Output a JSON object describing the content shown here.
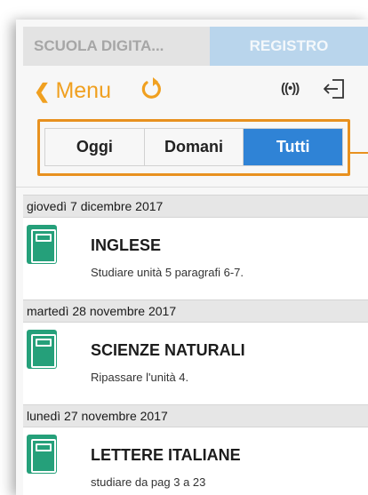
{
  "top_tabs": {
    "school_label": "SCUOLA DIGITA...",
    "registry_label": "REGISTRO"
  },
  "navbar": {
    "back_label": "Menu",
    "back_chevron": "❮",
    "signal_glyph": "((•))",
    "icons": [
      "chevron-left-icon",
      "refresh-icon",
      "signal-icon",
      "logout-icon"
    ]
  },
  "filter": {
    "options": [
      "Oggi",
      "Domani",
      "Tutti"
    ],
    "selected": "Tutti"
  },
  "colors": {
    "accent": "#f0a020",
    "highlight": "#e8911f",
    "selected": "#2f83d6",
    "book": "#25a07a"
  },
  "entries": [
    {
      "date": "giovedì 7 dicembre 2017",
      "subject": "INGLESE",
      "task": "Studiare unità 5 paragrafi 6-7."
    },
    {
      "date": "martedì 28 novembre 2017",
      "subject": "SCIENZE NATURALI",
      "task": "Ripassare l'unità 4."
    },
    {
      "date": "lunedì 27 novembre 2017",
      "subject": "LETTERE ITALIANE",
      "task": "studiare da pag 3 a 23"
    }
  ]
}
